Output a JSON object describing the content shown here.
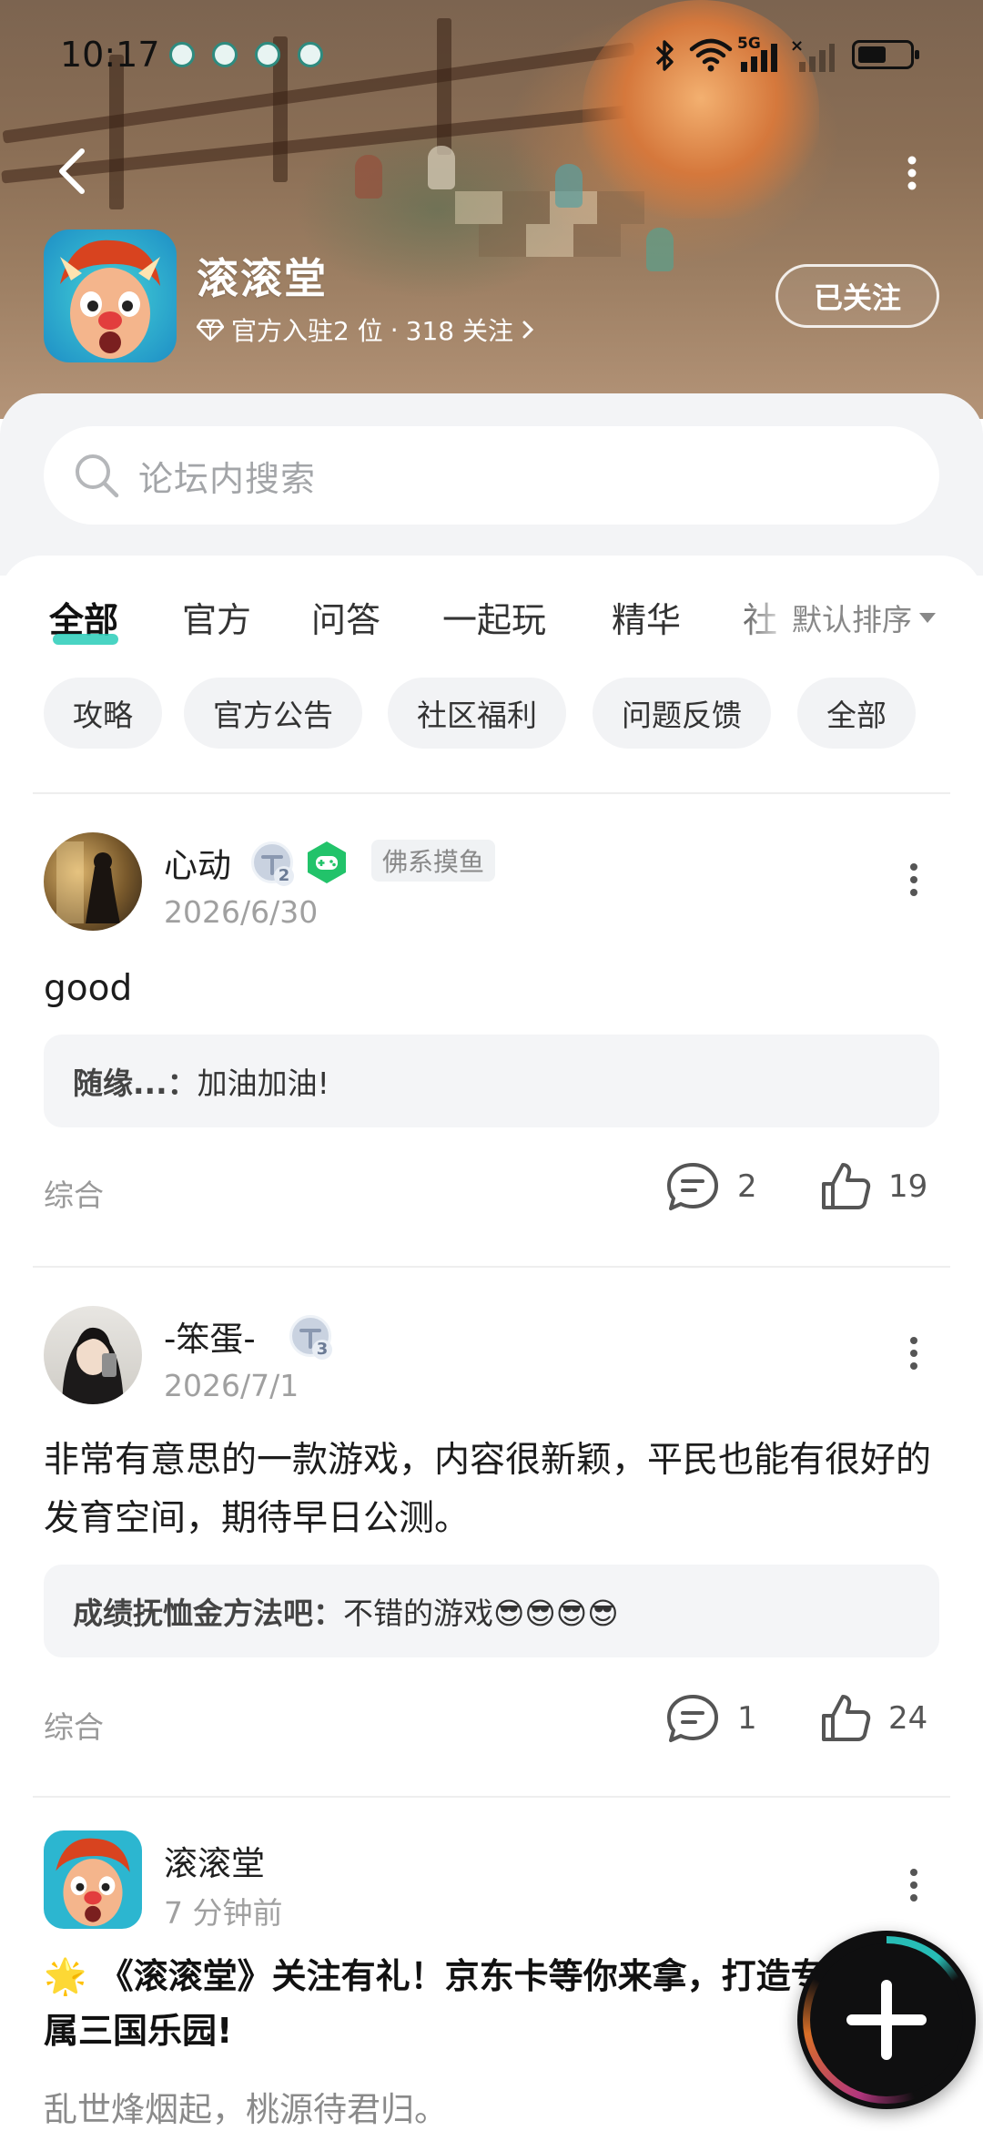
{
  "status_bar": {
    "time": "10:17",
    "signal_label": "5G",
    "battery_percent": 55,
    "icons": [
      "notification-icon",
      "bluetooth-icon",
      "wifi-icon",
      "signal-icon",
      "battery-icon"
    ]
  },
  "forum": {
    "name": "滚滚堂",
    "meta_official": "官方入驻2 位",
    "meta_separator": "·",
    "meta_follow": "318 关注",
    "follow_button": "已关注"
  },
  "search": {
    "placeholder": "论坛内搜索"
  },
  "tabs": [
    {
      "label": "全部",
      "active": true
    },
    {
      "label": "官方",
      "active": false
    },
    {
      "label": "问答",
      "active": false
    },
    {
      "label": "一起玩",
      "active": false
    },
    {
      "label": "精华",
      "active": false
    },
    {
      "label": "社",
      "active": false
    }
  ],
  "sort": {
    "label": "默认排序"
  },
  "chips": [
    "攻略",
    "官方公告",
    "社区福利",
    "问题反馈",
    "全部"
  ],
  "posts": [
    {
      "username": "心动",
      "level": "2",
      "tag": "佛系摸鱼",
      "date": "2026/6/30",
      "body": "good",
      "reply_author": "随缘...：",
      "reply_text": "加油加油!",
      "category": "综合",
      "comments": "2",
      "likes": "19"
    },
    {
      "username": "-笨蛋-",
      "level": "3",
      "date": "2026/7/1",
      "body": "非常有意思的一款游戏，内容很新颖，平民也能有很好的发育空间，期待早日公测。",
      "reply_author": "成绩抚恤金方法吧：",
      "reply_text": "不错的游戏😎😎😎😎",
      "category": "综合",
      "comments": "1",
      "likes": "24"
    },
    {
      "username": "滚滚堂",
      "date": "7 分钟前",
      "title_emoji": "🌟",
      "title": "《滚滚堂》关注有礼！京东卡等你来拿，打造专属三国乐园!",
      "body": "乱世烽烟起，桃源待君归。"
    }
  ],
  "colors": {
    "accent_teal": "#29cdb8",
    "header_brown": "#8a6e55",
    "game_badge_green": "#22c36a"
  }
}
